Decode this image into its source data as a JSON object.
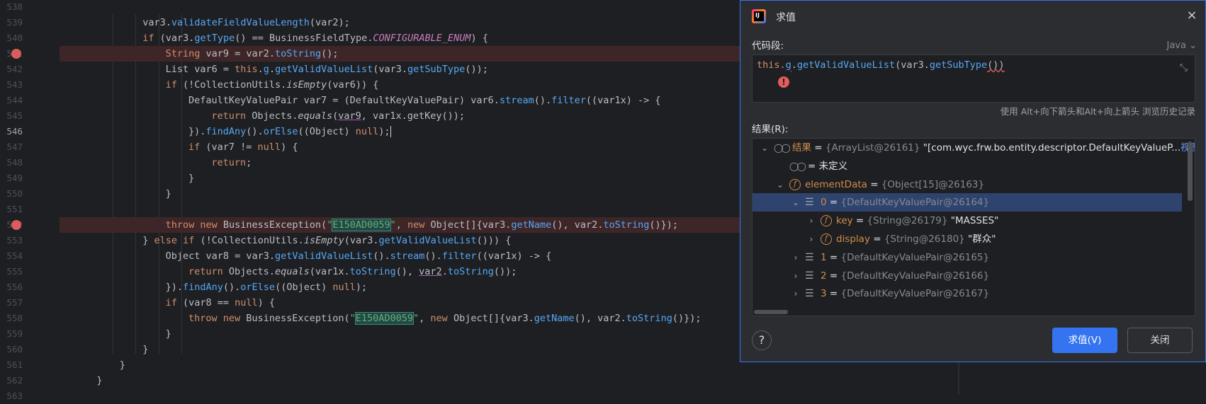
{
  "editor": {
    "lines": [
      {
        "num": "538",
        "indent": 0,
        "tokens": []
      },
      {
        "num": "539",
        "indent": 3,
        "tokens": [
          [
            "p",
            "var3."
          ],
          [
            "fn",
            "validateFieldValueLength"
          ],
          [
            "p",
            "(var2);"
          ]
        ]
      },
      {
        "num": "540",
        "indent": 3,
        "tokens": [
          [
            "kw",
            "if"
          ],
          [
            "p",
            " (var3."
          ],
          [
            "fn",
            "getType"
          ],
          [
            "p",
            "() == "
          ],
          [
            "cls",
            "BusinessFieldType"
          ],
          [
            "p",
            "."
          ],
          [
            "sf",
            "CONFIGURABLE_ENUM"
          ],
          [
            "p",
            ") {"
          ]
        ]
      },
      {
        "num": "541",
        "indent": 4,
        "breakpoint": true,
        "tokens": [
          [
            "kw",
            "String"
          ],
          [
            "p",
            " var9 = var2."
          ],
          [
            "fn",
            "toString"
          ],
          [
            "p",
            "();"
          ]
        ]
      },
      {
        "num": "542",
        "indent": 4,
        "tokens": [
          [
            "p",
            "List var6 = "
          ],
          [
            "kw",
            "this"
          ],
          [
            "p",
            "."
          ],
          [
            "fn",
            "g"
          ],
          [
            "p",
            "."
          ],
          [
            "fn",
            "getValidValueList"
          ],
          [
            "p",
            "(var3."
          ],
          [
            "fn",
            "getSubType"
          ],
          [
            "p",
            "());"
          ]
        ]
      },
      {
        "num": "543",
        "indent": 4,
        "tokens": [
          [
            "kw",
            "if"
          ],
          [
            "p",
            " (!"
          ],
          [
            "cls",
            "CollectionUtils"
          ],
          [
            "p",
            "."
          ],
          [
            "it",
            "isEmpty"
          ],
          [
            "p",
            "(var6)) {"
          ]
        ]
      },
      {
        "num": "544",
        "indent": 5,
        "tokens": [
          [
            "cls",
            "DefaultKeyValuePair"
          ],
          [
            "p",
            " var7 = ("
          ],
          [
            "cls",
            "DefaultKeyValuePair"
          ],
          [
            "p",
            ") var6."
          ],
          [
            "fn",
            "stream"
          ],
          [
            "p",
            "()."
          ],
          [
            "fn",
            "filter"
          ],
          [
            "p",
            "((var1x) -> {"
          ]
        ]
      },
      {
        "num": "545",
        "indent": 6,
        "tokens": [
          [
            "kw",
            "return"
          ],
          [
            "p",
            " Objects."
          ],
          [
            "it",
            "equals"
          ],
          [
            "p",
            "("
          ],
          [
            "lv",
            "var9"
          ],
          [
            "p",
            ", var1x.getKey());"
          ]
        ]
      },
      {
        "num": "546",
        "indent": 5,
        "current": true,
        "tokens": [
          [
            "p",
            "})."
          ],
          [
            "fn",
            "findAny"
          ],
          [
            "p",
            "()."
          ],
          [
            "fn",
            "orElse"
          ],
          [
            "p",
            "(("
          ],
          [
            "cls",
            "Object"
          ],
          [
            "p",
            ") "
          ],
          [
            "kw",
            "null"
          ],
          [
            "p",
            ");"
          ],
          [
            "caret",
            ""
          ]
        ]
      },
      {
        "num": "547",
        "indent": 5,
        "tokens": [
          [
            "kw",
            "if"
          ],
          [
            "p",
            " (var7 != "
          ],
          [
            "kw",
            "null"
          ],
          [
            "p",
            ") {"
          ]
        ]
      },
      {
        "num": "548",
        "indent": 6,
        "tokens": [
          [
            "kw",
            "return"
          ],
          [
            "p",
            ";"
          ]
        ]
      },
      {
        "num": "549",
        "indent": 5,
        "tokens": [
          [
            "p",
            "}"
          ]
        ]
      },
      {
        "num": "550",
        "indent": 4,
        "tokens": [
          [
            "p",
            "}"
          ]
        ]
      },
      {
        "num": "551",
        "indent": 0,
        "tokens": []
      },
      {
        "num": "552",
        "indent": 4,
        "breakpoint": true,
        "tokens": [
          [
            "kw",
            "throw new"
          ],
          [
            "p",
            " BusinessException("
          ],
          [
            "str",
            "\""
          ],
          [
            "hl",
            "E150AD0059"
          ],
          [
            "str",
            "\""
          ],
          [
            "p",
            ", "
          ],
          [
            "kw",
            "new"
          ],
          [
            "p",
            " Object[]{var3."
          ],
          [
            "fn",
            "getName"
          ],
          [
            "p",
            "(), var2."
          ],
          [
            "fn",
            "toString"
          ],
          [
            "p",
            "()});"
          ]
        ]
      },
      {
        "num": "553",
        "indent": 3,
        "tokens": [
          [
            "p",
            "} "
          ],
          [
            "kw",
            "else if"
          ],
          [
            "p",
            " (!"
          ],
          [
            "cls",
            "CollectionUtils"
          ],
          [
            "p",
            "."
          ],
          [
            "it",
            "isEmpty"
          ],
          [
            "p",
            "(var3."
          ],
          [
            "fn",
            "getValidValueList"
          ],
          [
            "p",
            "())) {"
          ]
        ]
      },
      {
        "num": "554",
        "indent": 4,
        "tokens": [
          [
            "cls",
            "Object"
          ],
          [
            "p",
            " var8 = var3."
          ],
          [
            "fn",
            "getValidValueList"
          ],
          [
            "p",
            "()."
          ],
          [
            "fn",
            "stream"
          ],
          [
            "p",
            "()."
          ],
          [
            "fn",
            "filter"
          ],
          [
            "p",
            "((var1x) -> {"
          ]
        ]
      },
      {
        "num": "555",
        "indent": 5,
        "tokens": [
          [
            "kw",
            "return"
          ],
          [
            "p",
            " Objects."
          ],
          [
            "it",
            "equals"
          ],
          [
            "p",
            "(var1x."
          ],
          [
            "fn",
            "toString"
          ],
          [
            "p",
            "(), "
          ],
          [
            "lv",
            "var2"
          ],
          [
            "p",
            "."
          ],
          [
            "fn",
            "toString"
          ],
          [
            "p",
            "());"
          ]
        ]
      },
      {
        "num": "556",
        "indent": 4,
        "tokens": [
          [
            "p",
            "})."
          ],
          [
            "fn",
            "findAny"
          ],
          [
            "p",
            "()."
          ],
          [
            "fn",
            "orElse"
          ],
          [
            "p",
            "(("
          ],
          [
            "cls",
            "Object"
          ],
          [
            "p",
            ") "
          ],
          [
            "kw",
            "null"
          ],
          [
            "p",
            ");"
          ]
        ]
      },
      {
        "num": "557",
        "indent": 4,
        "tokens": [
          [
            "kw",
            "if"
          ],
          [
            "p",
            " (var8 == "
          ],
          [
            "kw",
            "null"
          ],
          [
            "p",
            ") {"
          ]
        ]
      },
      {
        "num": "558",
        "indent": 5,
        "tokens": [
          [
            "kw",
            "throw new"
          ],
          [
            "p",
            " BusinessException("
          ],
          [
            "str",
            "\""
          ],
          [
            "hl",
            "E150AD0059"
          ],
          [
            "str",
            "\""
          ],
          [
            "p",
            ", "
          ],
          [
            "kw",
            "new"
          ],
          [
            "p",
            " Object[]{var3."
          ],
          [
            "fn",
            "getName"
          ],
          [
            "p",
            "(), var2."
          ],
          [
            "fn",
            "toString"
          ],
          [
            "p",
            "()});"
          ]
        ]
      },
      {
        "num": "559",
        "indent": 4,
        "tokens": [
          [
            "p",
            "}"
          ]
        ]
      },
      {
        "num": "560",
        "indent": 3,
        "tokens": [
          [
            "p",
            "}"
          ]
        ]
      },
      {
        "num": "561",
        "indent": 2,
        "tokens": [
          [
            "p",
            "}"
          ]
        ]
      },
      {
        "num": "562",
        "indent": 1,
        "tokens": [
          [
            "p",
            "}"
          ]
        ]
      },
      {
        "num": "563",
        "indent": 0,
        "tokens": []
      }
    ]
  },
  "dialog": {
    "title": "求值",
    "app_icon_text": "IJ",
    "close_icon": "×",
    "code_label": "代码段:",
    "language": "Java",
    "expression_prefix": "this.",
    "expression_g": "g",
    "expression_dot": ".",
    "expression_method": "getValidValueList",
    "expression_open": "(var3.",
    "expression_sub": "getSubType",
    "expression_close": "())",
    "error_icon": "!",
    "expand_icon": "⤡",
    "history_hint": "使用 Alt+向下箭头和Alt+向上箭头 浏览历史记录",
    "result_label": "结果(R):",
    "tree": [
      {
        "level": 0,
        "chevron": "⌄",
        "icon": "watch",
        "name": "结果",
        "name_class": "vname",
        "eq": " = ",
        "type": "{ArrayList@26161}",
        "value": " \"[com.wyc.frw.bo.entity.descriptor.DefaultKeyValueP...",
        "link": "视图"
      },
      {
        "level": 1,
        "chevron": "",
        "icon": "watch",
        "name": "",
        "name_class": "vname plain",
        "eq": "= 未定义",
        "type": "",
        "value": "",
        "link": ""
      },
      {
        "level": 1,
        "chevron": "⌄",
        "icon": "field",
        "name": "elementData",
        "name_class": "vname",
        "eq": " = ",
        "type": "{Object[15]@26163}",
        "value": "",
        "link": ""
      },
      {
        "level": 2,
        "chevron": "⌄",
        "icon": "list",
        "name": "0",
        "name_class": "vname",
        "eq": " = ",
        "type": "{DefaultKeyValuePair@26164}",
        "value": "",
        "link": "",
        "selected": true
      },
      {
        "level": 3,
        "chevron": "›",
        "icon": "field",
        "name": "key",
        "name_class": "vname",
        "eq": " = ",
        "type": "{String@26179}",
        "value": " \"MASSES\"",
        "link": ""
      },
      {
        "level": 3,
        "chevron": "›",
        "icon": "field",
        "name": "display",
        "name_class": "vname",
        "eq": " = ",
        "type": "{String@26180}",
        "value": " \"群众\"",
        "link": ""
      },
      {
        "level": 2,
        "chevron": "›",
        "icon": "list",
        "name": "1",
        "name_class": "vname",
        "eq": " = ",
        "type": "{DefaultKeyValuePair@26165}",
        "value": "",
        "link": ""
      },
      {
        "level": 2,
        "chevron": "›",
        "icon": "list",
        "name": "2",
        "name_class": "vname",
        "eq": " = ",
        "type": "{DefaultKeyValuePair@26166}",
        "value": "",
        "link": ""
      },
      {
        "level": 2,
        "chevron": "›",
        "icon": "list",
        "name": "3",
        "name_class": "vname",
        "eq": " = ",
        "type": "{DefaultKeyValuePair@26167}",
        "value": "",
        "link": ""
      }
    ],
    "help_label": "?",
    "evaluate_button": "求值(V)",
    "close_button": "关闭"
  },
  "colors": {
    "accent": "#3574f0",
    "breakpoint": "#db5c5c",
    "keyword": "#cf8e6d",
    "method": "#56a8f5",
    "string": "#6aab73"
  }
}
